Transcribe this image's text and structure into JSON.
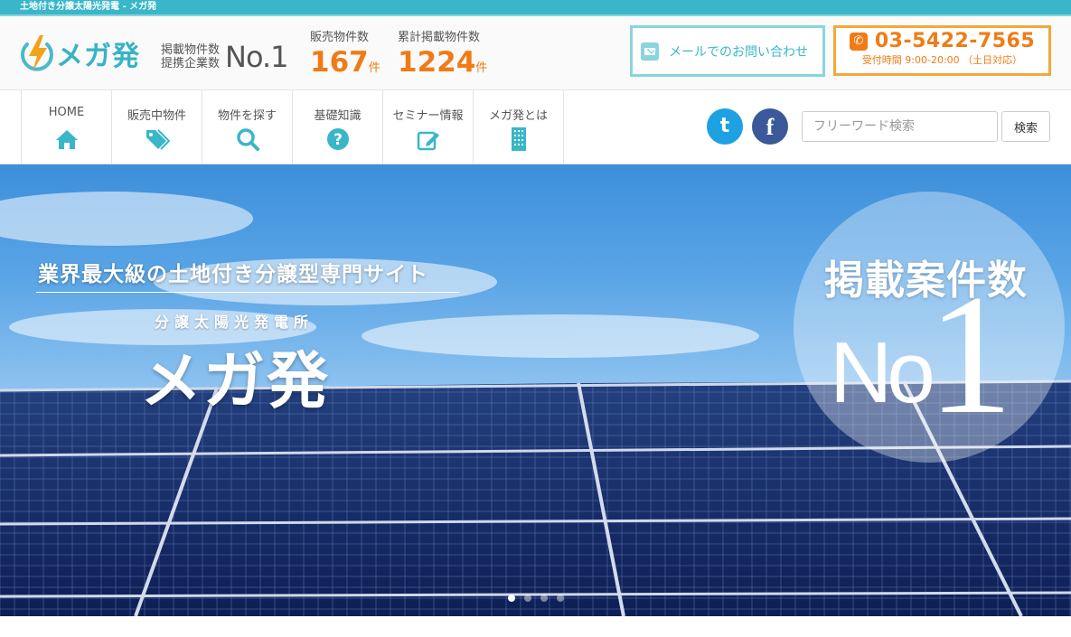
{
  "topbar": {
    "text": "土地付き分譲太陽光発電 - メガ発"
  },
  "header": {
    "logo_text": "メガ発",
    "no1_label_1": "掲載物件数",
    "no1_label_2": "提携企業数",
    "no1_value": "No.1",
    "stats": [
      {
        "label": "販売物件数",
        "value": "167",
        "unit": "件"
      },
      {
        "label": "累計掲載物件数",
        "value": "1224",
        "unit": "件"
      }
    ],
    "mail_label": "メールでのお問い合わせ",
    "tel_number": "03-5422-7565",
    "tel_hours": "受付時間 9:00-20:00 （土日対応）"
  },
  "nav": {
    "items": [
      {
        "label": "HOME",
        "icon": "home-icon"
      },
      {
        "label": "販売中物件",
        "icon": "tags-icon"
      },
      {
        "label": "物件を探す",
        "icon": "search-icon"
      },
      {
        "label": "基礎知識",
        "icon": "question-icon"
      },
      {
        "label": "セミナー情報",
        "icon": "edit-icon"
      },
      {
        "label": "メガ発とは",
        "icon": "building-icon"
      }
    ],
    "search_placeholder": "フリーワード検索",
    "search_button": "検索",
    "twitter_glyph": "t",
    "facebook_glyph": "f"
  },
  "hero": {
    "subtitle": "業界最大級の土地付き分譲型専門サイト",
    "small_title": "分譲太陽光発電所",
    "brand": "メガ発",
    "badge_title": "掲載案件数",
    "badge_no": "No",
    "badge_one": "1",
    "slides": 4,
    "active_slide": 1
  },
  "colors": {
    "accent": "#39b7c8",
    "orange": "#f07b16",
    "navy": "#1a2f6e"
  }
}
